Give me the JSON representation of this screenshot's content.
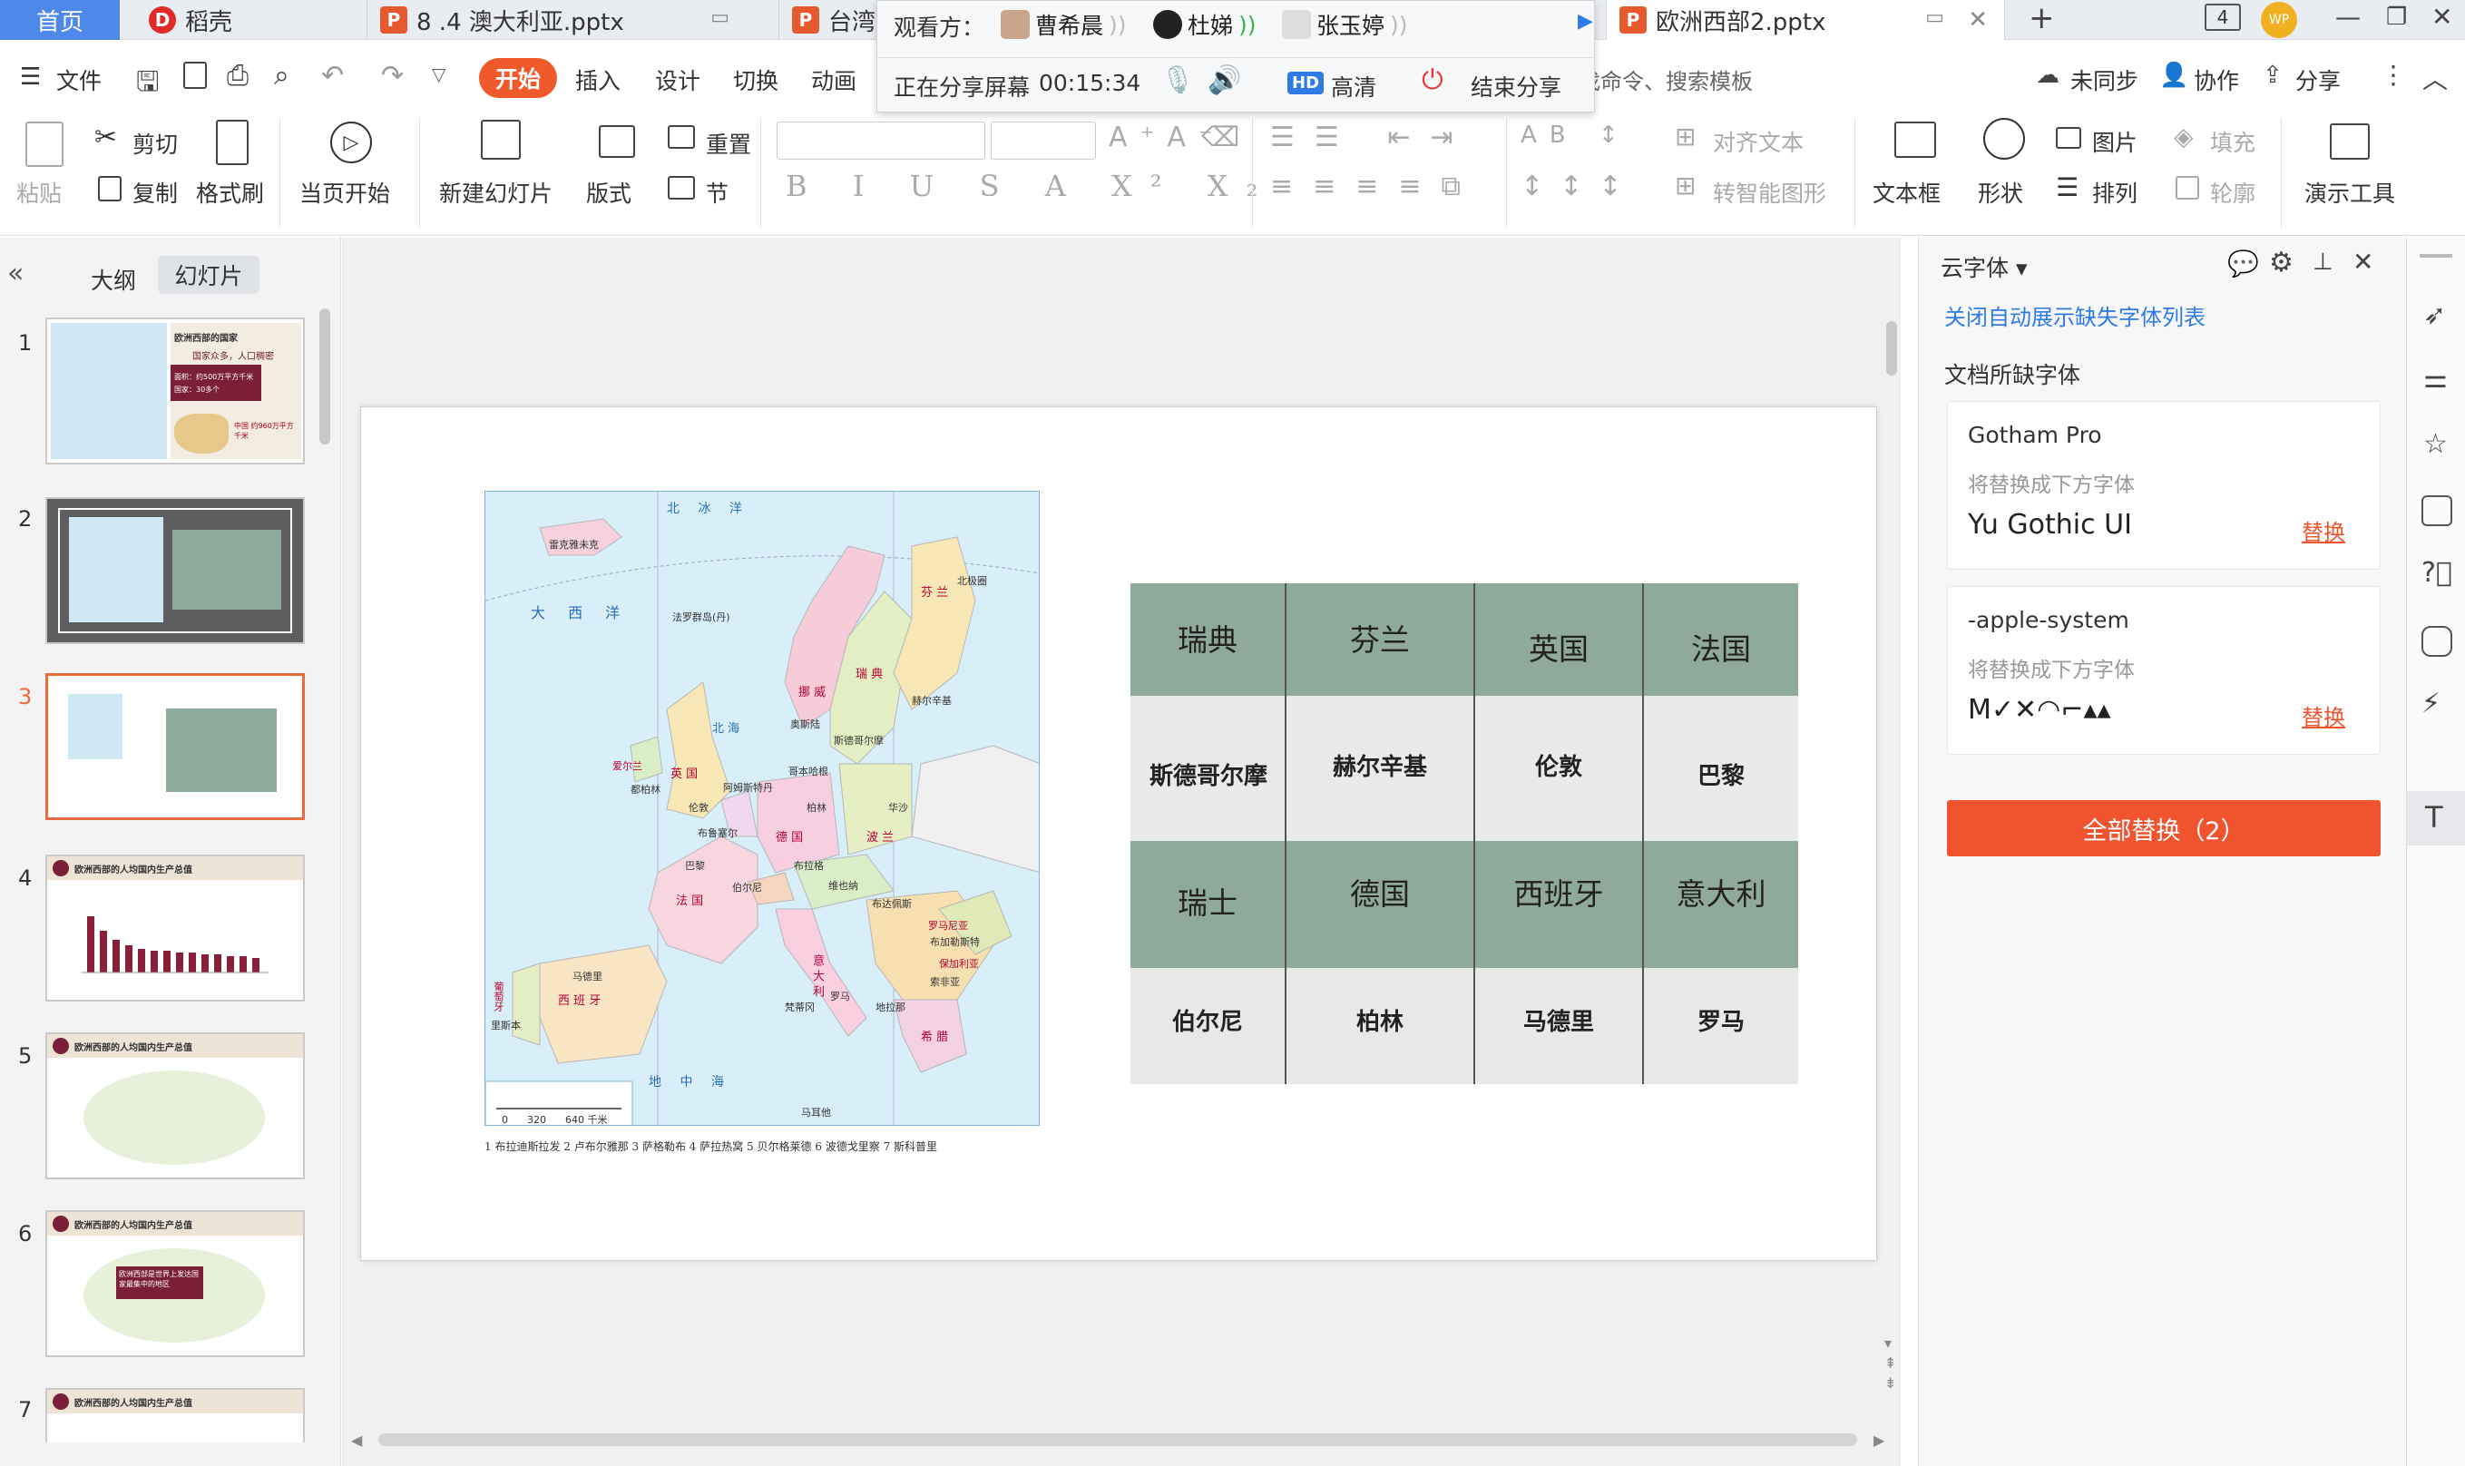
{
  "tabs": {
    "home": "首页",
    "daoke": "稻壳",
    "file1": "8 .4 澳大利亚.pptx",
    "file2": "台湾",
    "active": "欧洲西部2.pptx",
    "page_counter": "4"
  },
  "share": {
    "viewers_label": "观看方：",
    "viewers": [
      "曹希晨",
      "杜娣",
      "张玉婷"
    ],
    "status": "正在分享屏幕",
    "time": "00:15:34",
    "hd_badge": "HD",
    "hd_label": "高清",
    "end_label": "结束分享"
  },
  "menu": {
    "file": "文件",
    "start": "开始",
    "insert": "插入",
    "design": "设计",
    "transition": "切换",
    "animation": "动画",
    "search_hint": "找命令、搜索模板",
    "sync": "未同步",
    "collab": "协作",
    "share": "分享"
  },
  "ribbon": {
    "paste": "粘贴",
    "cut": "剪切",
    "copy": "复制",
    "format_painter": "格式刷",
    "from_start": "当页开始",
    "new_slide": "新建幻灯片",
    "layout": "版式",
    "reset": "重置",
    "section": "节",
    "align_text": "对齐文本",
    "smart_art": "转智能图形",
    "textbox": "文本框",
    "shape": "形状",
    "picture": "图片",
    "arrange": "排列",
    "fill": "填充",
    "outline": "轮廓",
    "presenter_tools": "演示工具"
  },
  "left_panel": {
    "outline_tab": "大纲",
    "slides_tab": "幻灯片",
    "slide_numbers": [
      "1",
      "2",
      "3",
      "4",
      "5",
      "6",
      "7"
    ],
    "t1_title": "欧洲西部的国家",
    "t1_sub": "国家众多，人口稠密",
    "t1_b1": "面积：约500万平方千米",
    "t1_b2": "国家：30多个",
    "t1_cn": "中国 约960万平方千米",
    "t4_title": "欧洲西部的人均国内生产总值",
    "t5_title": "欧洲西部的人均国内生产总值",
    "t6_title": "欧洲西部的人均国内生产总值",
    "t6_box": "欧洲西部是世界上发达国家最集中的地区",
    "t7_title": "欧洲西部的人均国内生产总值"
  },
  "slide": {
    "map_labels": {
      "north_pole": "北极圈",
      "north_ice": "北 冰 洋",
      "atlantic": "大 西 洋",
      "faroe": "法罗群岛(丹)",
      "iceland": "雷克雅未克",
      "norway": "挪 威",
      "sweden": "瑞 典",
      "finland": "芬 兰",
      "helsinki": "赫尔辛基",
      "oslo": "奥斯陆",
      "stockholm": "斯德哥尔摩",
      "copenhagen": "哥本哈根",
      "north_sea": "北 海",
      "uk": "英 国",
      "ireland": "爱尔兰",
      "london": "伦敦",
      "dublin": "都柏林",
      "amsterdam": "阿姆斯特丹",
      "berlin": "柏林",
      "germany": "德 国",
      "poland": "波 兰",
      "warsaw": "华沙",
      "brussels": "布鲁塞尔",
      "paris": "巴黎",
      "france": "法 国",
      "bern": "伯尔尼",
      "prague": "布拉格",
      "vienna": "维也纳",
      "budapest": "布达佩斯",
      "romania": "罗马尼亚",
      "bucharest": "布加勒斯特",
      "bulgaria": "保加利亚",
      "sofia": "索非亚",
      "greece": "希 腊",
      "italy": "意 大 利",
      "rome": "罗马",
      "spain": "西 班 牙",
      "madrid": "马德里",
      "portugal": "葡萄牙",
      "lisbon": "里斯本",
      "mediterranean": "地 中 海",
      "tirana": "地拉那",
      "vatican": "梵蒂冈",
      "malta": "马耳他",
      "scale": "0      320      640 千米",
      "footnote": "1 布拉迪斯拉发  2 卢布尔雅那  3 萨格勒布  4 萨拉热窝  5 贝尔格莱德  6 波德戈里察  7 斯科普里"
    },
    "placards_top": [
      "瑞典",
      "芬兰",
      "英国",
      "法国"
    ],
    "capitals_top": [
      "斯德哥尔摩",
      "赫尔辛基",
      "伦敦",
      "巴黎"
    ],
    "placards_bottom": [
      "瑞士",
      "德国",
      "西班牙",
      "意大利"
    ],
    "capitals_bottom": [
      "伯尔尼",
      "柏林",
      "马德里",
      "罗马"
    ]
  },
  "font_panel": {
    "title": "云字体",
    "link": "关闭自动展示缺失字体列表",
    "section": "文档所缺字体",
    "replace_hint": "将替换成下方字体",
    "font1_missing": "Gotham Pro",
    "font1_replace": "Yu Gothic UI",
    "font2_missing": "-apple-system",
    "font2_preview": "M✓✕◠⌐▴▴",
    "replace_link": "替换",
    "replace_all": "全部替换（2）"
  },
  "colors": {
    "accent_blue": "#4e88e8",
    "start_orange": "#f0592a",
    "replace_red": "#f0542f",
    "link_blue": "#2f7be5",
    "selected_border": "#e86b3d"
  }
}
